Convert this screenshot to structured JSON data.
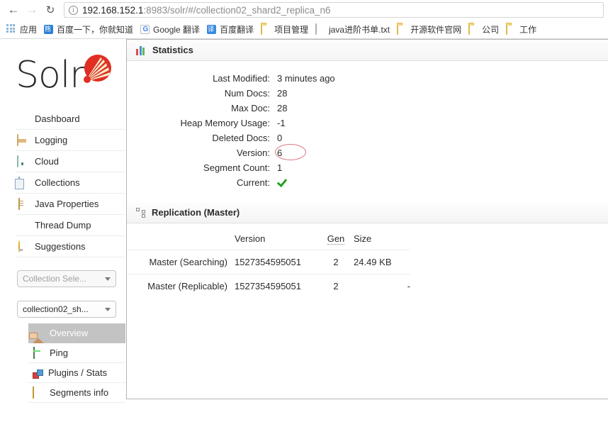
{
  "browser": {
    "back_icon": "back-arrow-icon",
    "forward_icon": "forward-arrow-icon",
    "reload_icon": "reload-icon",
    "info_glyph": "i",
    "url_host": "192.168.152.1",
    "url_path": ":8983/solr/#/collection02_shard2_replica_n6",
    "url_full": "192.168.152.1:8983/solr/#/collection02_shard2_replica_n6",
    "bookmarks": [
      {
        "label": "应用",
        "icon": "apps-grid-icon"
      },
      {
        "label": "百度一下，你就知道",
        "icon": "baidu-icon"
      },
      {
        "label": "Google 翻译",
        "icon": "google-translate-icon"
      },
      {
        "label": "百度翻译",
        "icon": "baidu-fanyi-icon"
      },
      {
        "label": "项目管理",
        "icon": "folder-icon"
      },
      {
        "label": "java进阶书单.txt",
        "icon": "document-icon"
      },
      {
        "label": "开源软件官网",
        "icon": "folder-icon"
      },
      {
        "label": "公司",
        "icon": "folder-icon"
      },
      {
        "label": "工作",
        "icon": "folder-icon"
      }
    ]
  },
  "sidebar": {
    "logo_text": "Solr",
    "logo_mark": "solr-sunburst-icon",
    "menu": [
      {
        "label": "Dashboard",
        "icon": "dashboard-icon"
      },
      {
        "label": "Logging",
        "icon": "logging-icon"
      },
      {
        "label": "Cloud",
        "icon": "cloud-icon"
      },
      {
        "label": "Collections",
        "icon": "collections-icon"
      },
      {
        "label": "Java Properties",
        "icon": "java-properties-icon"
      },
      {
        "label": "Thread Dump",
        "icon": "thread-dump-icon"
      },
      {
        "label": "Suggestions",
        "icon": "suggestions-icon"
      }
    ],
    "collection_selector": {
      "value": "Collection Sele...",
      "is_placeholder": true
    },
    "core_selector": {
      "value": "collection02_sh...",
      "is_placeholder": false
    },
    "sub_menu": [
      {
        "label": "Overview",
        "icon": "home-icon",
        "active": true
      },
      {
        "label": "Ping",
        "icon": "ping-icon",
        "active": false
      },
      {
        "label": "Plugins / Stats",
        "icon": "plugins-icon",
        "active": false
      },
      {
        "label": "Segments info",
        "icon": "segments-icon",
        "active": false
      }
    ]
  },
  "statistics": {
    "title": "Statistics",
    "icon": "bar-chart-icon",
    "rows": [
      {
        "key": "Last Modified:",
        "value": "3 minutes ago"
      },
      {
        "key": "Num Docs:",
        "value": "28"
      },
      {
        "key": "Max Doc:",
        "value": "28"
      },
      {
        "key": "Heap Memory Usage:",
        "value": "-1"
      },
      {
        "key": "Deleted Docs:",
        "value": "0"
      },
      {
        "key": "Version:",
        "value": "6"
      },
      {
        "key": "Segment Count:",
        "value": "1"
      },
      {
        "key": "Current:",
        "value": ""
      }
    ],
    "current_icon": "green-checkmark-icon",
    "annotation": {
      "target": "Num Docs value",
      "shape": "ellipse",
      "color": "#d8737f"
    }
  },
  "replication": {
    "title": "Replication (Master)",
    "icon": "replication-nodes-icon",
    "columns": [
      "",
      "Version",
      "Gen",
      "Size"
    ],
    "rows": [
      {
        "label": "Master (Searching)",
        "version": "1527354595051",
        "gen": "2",
        "size": "24.49 KB"
      },
      {
        "label": "Master (Replicable)",
        "version": "1527354595051",
        "gen": "2",
        "size": "-"
      }
    ]
  }
}
